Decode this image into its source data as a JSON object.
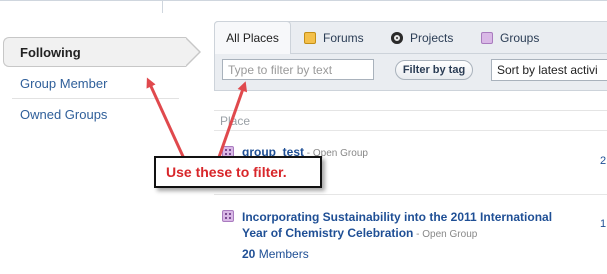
{
  "sidebar": {
    "items": [
      {
        "label": "Following"
      },
      {
        "label": "Group Member"
      },
      {
        "label": "Owned Groups"
      }
    ]
  },
  "tabs": [
    {
      "label": "All Places",
      "icon": "none"
    },
    {
      "label": "Forums",
      "icon": "forum-icon"
    },
    {
      "label": "Projects",
      "icon": "project-icon"
    },
    {
      "label": "Groups",
      "icon": "group-icon"
    }
  ],
  "filter": {
    "placeholder": "Type to filter by text",
    "tag_button": "Filter by tag",
    "sort_value": "Sort by latest activi"
  },
  "table": {
    "column_header": "Place"
  },
  "places": [
    {
      "title": "group_test",
      "type": " - Open Group",
      "right": "2"
    },
    {
      "title": "Incorporating Sustainability into the 2011 International",
      "title2": "Year of Chemistry Celebration",
      "type": " - Open Group",
      "members_count": "20",
      "members_label": " Members",
      "right": "1"
    }
  ],
  "callout": {
    "text": "Use these to filter."
  },
  "colors": {
    "arrow": "#e0494d",
    "callout_text": "#d8262a",
    "link": "#1f4f95"
  }
}
